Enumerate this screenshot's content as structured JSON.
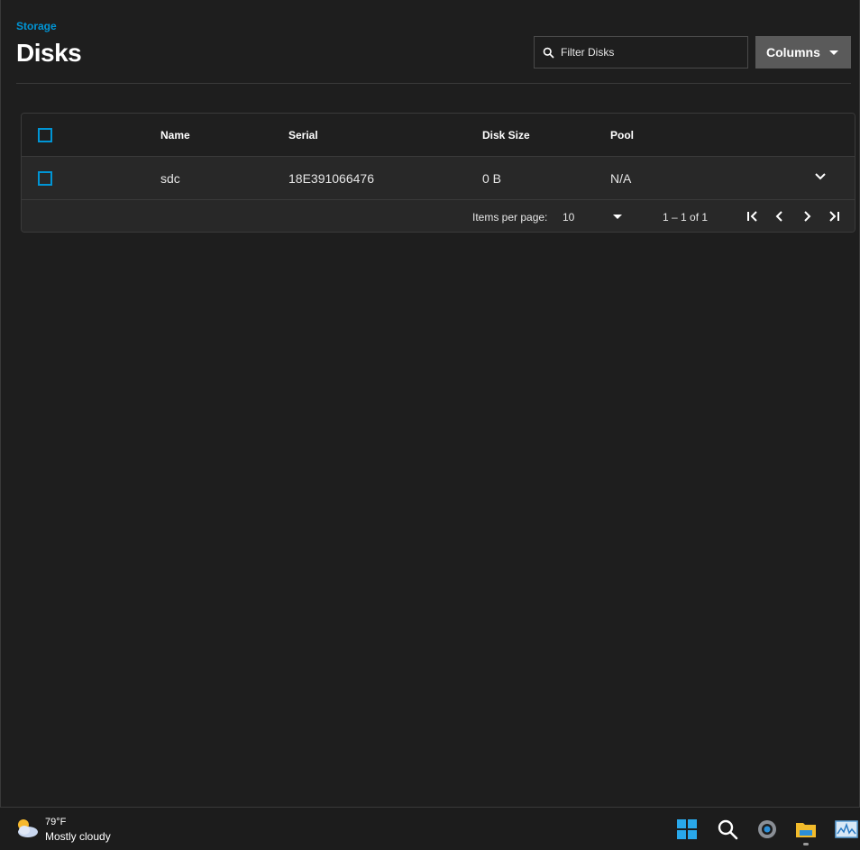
{
  "breadcrumb": "Storage",
  "page_title": "Disks",
  "search": {
    "placeholder": "Filter Disks",
    "value": ""
  },
  "columns_button": {
    "label": "Columns",
    "icon": "caret-down-icon"
  },
  "table": {
    "headers": [
      "Name",
      "Serial",
      "Disk Size",
      "Pool"
    ],
    "rows": [
      {
        "name": "sdc",
        "serial": "18E391066476",
        "disk_size": "0 B",
        "pool": "N/A"
      }
    ]
  },
  "paginator": {
    "items_per_page_label": "Items per page:",
    "items_per_page_value": "10",
    "range_label": "1 – 1 of 1"
  },
  "taskbar": {
    "weather_temp": "79°F",
    "weather_desc": "Mostly cloudy",
    "icons": [
      "weather-icon",
      "start-icon",
      "search-icon",
      "settings-icon",
      "file-explorer-icon",
      "resource-monitor-icon"
    ]
  },
  "colors": {
    "accent": "#0095d5",
    "background": "#1e1e1e",
    "card": "#282828"
  }
}
